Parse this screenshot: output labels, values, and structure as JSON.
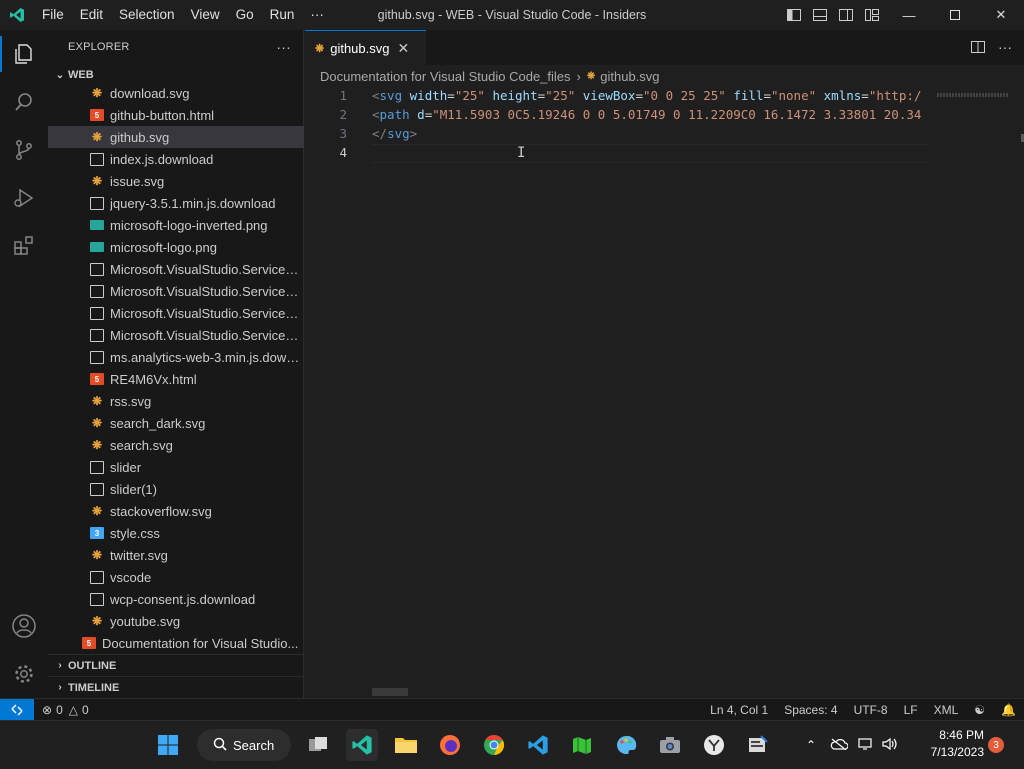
{
  "titlebar": {
    "menu": [
      "File",
      "Edit",
      "Selection",
      "View",
      "Go",
      "Run",
      "···"
    ],
    "title": "github.svg - WEB - Visual Studio Code - Insiders"
  },
  "activity": [
    "explorer-icon",
    "search-icon",
    "source-control-icon",
    "run-debug-icon",
    "extensions-icon",
    "accounts-icon",
    "manage-gear-icon"
  ],
  "sidebar": {
    "header": "EXPLORER",
    "more": "···",
    "root": "WEB",
    "files": [
      {
        "name": "download.svg",
        "icon": "svg"
      },
      {
        "name": "github-button.html",
        "icon": "html"
      },
      {
        "name": "github.svg",
        "icon": "svg",
        "selected": true
      },
      {
        "name": "index.js.download",
        "icon": "doc"
      },
      {
        "name": "issue.svg",
        "icon": "svg"
      },
      {
        "name": "jquery-3.5.1.min.js.download",
        "icon": "doc"
      },
      {
        "name": "microsoft-logo-inverted.png",
        "icon": "png"
      },
      {
        "name": "microsoft-logo.png",
        "icon": "png"
      },
      {
        "name": "Microsoft.VisualStudio.Services....",
        "icon": "doc"
      },
      {
        "name": "Microsoft.VisualStudio.Services....",
        "icon": "doc"
      },
      {
        "name": "Microsoft.VisualStudio.Services....",
        "icon": "doc"
      },
      {
        "name": "Microsoft.VisualStudio.Services....",
        "icon": "doc"
      },
      {
        "name": "ms.analytics-web-3.min.js.down...",
        "icon": "doc"
      },
      {
        "name": "RE4M6Vx.html",
        "icon": "html"
      },
      {
        "name": "rss.svg",
        "icon": "svg"
      },
      {
        "name": "search_dark.svg",
        "icon": "svg"
      },
      {
        "name": "search.svg",
        "icon": "svg"
      },
      {
        "name": "slider",
        "icon": "doc"
      },
      {
        "name": "slider(1)",
        "icon": "doc"
      },
      {
        "name": "stackoverflow.svg",
        "icon": "svg"
      },
      {
        "name": "style.css",
        "icon": "css"
      },
      {
        "name": "twitter.svg",
        "icon": "svg"
      },
      {
        "name": "vscode",
        "icon": "doc"
      },
      {
        "name": "wcp-consent.js.download",
        "icon": "doc"
      },
      {
        "name": "youtube.svg",
        "icon": "svg"
      }
    ],
    "root_file": {
      "name": "Documentation for Visual Studio...",
      "icon": "html"
    },
    "outline": "OUTLINE",
    "timeline": "TIMELINE"
  },
  "editor": {
    "tab_label": "github.svg",
    "breadcrumb": [
      "Documentation for Visual Studio Code_files",
      "github.svg"
    ],
    "lines": [
      {
        "num": "1",
        "text": "<svg width=\"25\" height=\"25\" viewBox=\"0 0 25 25\" fill=\"none\" xmlns=\"http:/"
      },
      {
        "num": "2",
        "text": "<path d=\"M11.5903 0C5.19246 0 0 5.01749 0 11.2209C0 16.1472 3.33801 20.34"
      },
      {
        "num": "3",
        "text": "</svg>"
      },
      {
        "num": "4",
        "text": ""
      }
    ]
  },
  "status": {
    "errors": "0",
    "warnings": "0",
    "position": "Ln 4, Col 1",
    "spaces": "Spaces: 4",
    "encoding": "UTF-8",
    "eol": "LF",
    "language": "XML"
  },
  "taskbar": {
    "search_label": "Search",
    "time": "8:46 PM",
    "date": "7/13/2023",
    "notifications": "3"
  },
  "colors": {
    "accent": "#0078d4",
    "svg_icon": "#e8a33d",
    "html_icon": "#e34c26",
    "tag": "#569cd6",
    "attr": "#9cdcfe",
    "string": "#ce9178"
  }
}
